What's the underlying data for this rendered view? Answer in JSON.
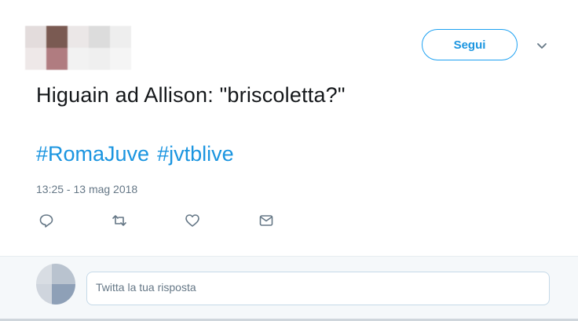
{
  "header": {
    "follow_label": "Segui",
    "menu_icon": "chevron-down-icon"
  },
  "tweet": {
    "text": "Higuain ad Allison: \"briscoletta?\"",
    "hashtags": [
      "#RomaJuve",
      "#jvtblive"
    ],
    "timestamp": "13:25 - 13 mag 2018"
  },
  "actions": [
    {
      "name": "reply-icon"
    },
    {
      "name": "retweet-icon"
    },
    {
      "name": "like-icon"
    },
    {
      "name": "direct-message-icon"
    }
  ],
  "reply": {
    "placeholder": "Twitta la tua risposta"
  },
  "colors": {
    "accent": "#1da1f2",
    "link": "#1b95e0",
    "text": "#14171a",
    "muted": "#657786",
    "reply_bg": "#f5f8fa"
  }
}
